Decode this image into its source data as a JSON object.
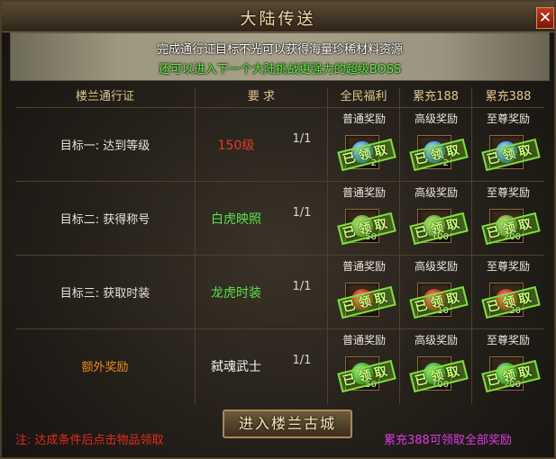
{
  "window": {
    "title": "大陆传送",
    "close_label": "✕"
  },
  "banner": {
    "line1": "完成通行证目标不光可以获得海量珍稀材料资源",
    "line2": "还可以进入下一个大陆挑战更强力的超级BOSS"
  },
  "headers": {
    "pass": "楼兰通行证",
    "requirement": "要 求",
    "tier_free": "全民福利",
    "tier_188": "累充188",
    "tier_388": "累充388"
  },
  "tier_labels": {
    "normal": "普通奖励",
    "advanced": "高级奖励",
    "supreme": "至尊奖励"
  },
  "claimed_stamp": "已领取",
  "rows": [
    {
      "label": "目标一:  达到等级",
      "requirement": "150级",
      "req_color": "#e23a2a",
      "progress": "1/1",
      "rewards": [
        {
          "icon": "blue-orb",
          "count": "2"
        },
        {
          "icon": "blue-orb",
          "count": "2"
        },
        {
          "icon": "blue-orb",
          "count": ""
        }
      ]
    },
    {
      "label": "目标二:  获得称号",
      "requirement": "白虎映照",
      "req_color": "#5ce04a",
      "progress": "1/1",
      "rewards": [
        {
          "icon": "herb",
          "count": "50"
        },
        {
          "icon": "herb",
          "count": "100"
        },
        {
          "icon": "herb",
          "count": "200"
        }
      ]
    },
    {
      "label": "目标三:  获取时装",
      "requirement": "龙虎时装",
      "req_color": "#5ce04a",
      "progress": "1/1",
      "rewards": [
        {
          "icon": "red-crystal",
          "count": ""
        },
        {
          "icon": "red-crystal",
          "count": "10"
        },
        {
          "icon": "red-crystal",
          "count": "20"
        }
      ]
    },
    {
      "label": "额外奖励",
      "label_color": "#f08a1a",
      "requirement": "弑魂武士",
      "req_color": "#f2f2f2",
      "progress": "1/1",
      "rewards": [
        {
          "icon": "green-leaf",
          "count": "50"
        },
        {
          "icon": "green-leaf",
          "count": "100"
        },
        {
          "icon": "green-leaf",
          "count": "200"
        }
      ]
    }
  ],
  "buttons": {
    "enter": "进入楼兰古城"
  },
  "footer": {
    "note": "注: 达成条件后点击物品领取",
    "vip_note": "累充388可领取全部奖励"
  },
  "colors": {
    "accent_gold": "#e5c48a",
    "stamp_green": "#7fe03a",
    "note_red": "#e32b1e",
    "vip_magenta": "#e03ae6"
  }
}
